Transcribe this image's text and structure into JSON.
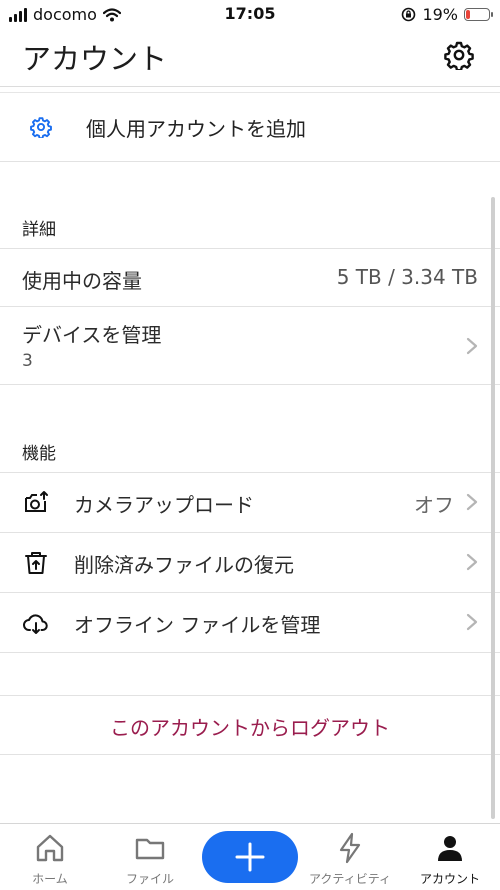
{
  "status_bar": {
    "carrier": "docomo",
    "time": "17:05",
    "battery_percent": "19%",
    "battery_level": 0.19
  },
  "header": {
    "title": "アカウント"
  },
  "add_account": {
    "label": "個人用アカウントを追加"
  },
  "details": {
    "section_title": "詳細",
    "storage_label": "使用中の容量",
    "storage_value": "5 TB / 3.34 TB",
    "devices_label": "デバイスを管理",
    "devices_count": "3"
  },
  "features": {
    "section_title": "機能",
    "items": [
      {
        "label": "カメラアップロード",
        "value": "オフ",
        "icon": "camera-upload-icon"
      },
      {
        "label": "削除済みファイルの復元",
        "value": "",
        "icon": "restore-trash-icon"
      },
      {
        "label": "オフライン ファイルを管理",
        "value": "",
        "icon": "offline-cloud-icon"
      }
    ]
  },
  "logout": {
    "label": "このアカウントからログアウト",
    "color": "#9a1d4e"
  },
  "tab_bar": {
    "accent_color": "#1a6ef0",
    "tabs": [
      {
        "label": "ホーム",
        "icon": "home-icon"
      },
      {
        "label": "ファイル",
        "icon": "folder-icon"
      },
      {
        "label": "",
        "icon": "plus-icon"
      },
      {
        "label": "アクティビティ",
        "icon": "lightning-icon"
      },
      {
        "label": "アカウント",
        "icon": "person-icon"
      }
    ]
  }
}
